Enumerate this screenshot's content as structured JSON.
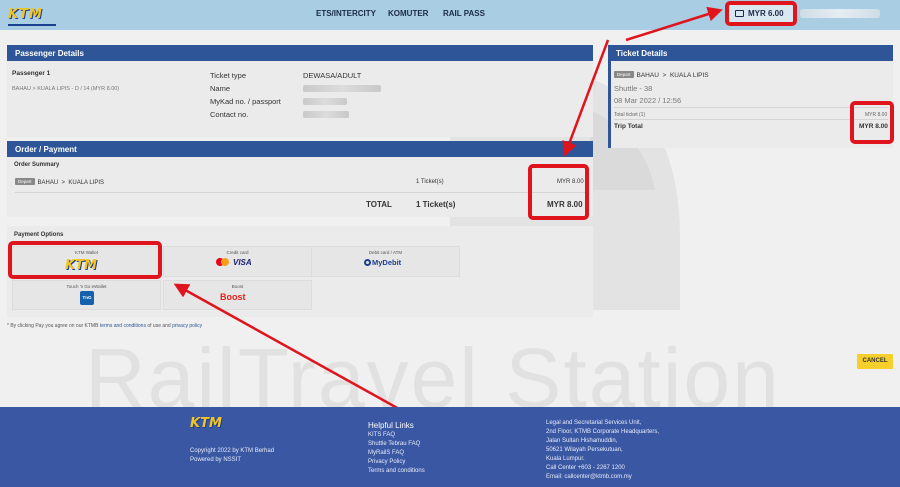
{
  "brand": {
    "logo_text": "KTM"
  },
  "nav": {
    "items": [
      "ETS/INTERCITY",
      "KOMUTER",
      "RAIL PASS"
    ]
  },
  "wallet": {
    "balance": "MYR 6.00",
    "icon": "wallet-icon"
  },
  "watermark": "RailTravel Station",
  "passenger_details": {
    "title": "Passenger Details",
    "passenger_label": "Passenger 1",
    "journey_summary": "BAHAU > KUALA LIPIS - D / 14 (MYR 8.00)",
    "fields": [
      {
        "label": "Ticket type",
        "value": "DEWASA/ADULT"
      },
      {
        "label": "Name",
        "value": ""
      },
      {
        "label": "MyKad no. / passport",
        "value": ""
      },
      {
        "label": "Contact no.",
        "value": ""
      }
    ]
  },
  "order": {
    "title": "Order / Payment",
    "summary_label": "Order Summary",
    "badge": "Depart",
    "origin": "BAHAU",
    "destination": "KUALA LIPIS",
    "tickets": "1 Ticket(s)",
    "price": "MYR 8.00",
    "total_label": "TOTAL",
    "total_tickets": "1 Ticket(s)",
    "total_price": "MYR 8.00"
  },
  "payment": {
    "title": "Payment Options",
    "options": [
      {
        "title": "KTM Wallet",
        "brand": "KTM"
      },
      {
        "title": "Credit card",
        "brand": "VISA"
      },
      {
        "title": "Debit card / ATM",
        "brand": "MyDebit"
      },
      {
        "title": "Touch 'n Go eWallet",
        "brand": "TnG"
      },
      {
        "title": "Boost",
        "brand": "Boost"
      }
    ],
    "terms_prefix": "* By clicking Pay you agree on our KTMB ",
    "terms_link": "terms and conditions",
    "terms_mid": " of use and ",
    "privacy_link": "privacy policy"
  },
  "ticket_details": {
    "title": "Ticket Details",
    "badge": "Depart",
    "origin": "BAHAU",
    "destination": "KUALA LIPIS",
    "service": "Shuttle - 38",
    "datetime": "08 Mar 2022 / 12:56",
    "total_ticket_label": "Total ticket (1)",
    "total_ticket_value": "MYR 8.00",
    "trip_total_label": "Trip Total",
    "trip_total_value": "MYR 8.00"
  },
  "actions": {
    "cancel": "CANCEL"
  },
  "footer": {
    "copyright": "Copyright 2022 by KTM Berhad",
    "powered": "Powered by NSSIT",
    "helpful_title": "Helpful Links",
    "links": [
      "KITS FAQ",
      "Shuttle Tebrau FAQ",
      "MyRailS FAQ",
      "Privacy Policy",
      "Terms and conditions"
    ],
    "address": [
      "Legal and Secretarial Services Unit,",
      "2nd Floor, KTMB Corporate Headquarters,",
      "Jalan Sultan Hishamuddin,",
      "50621 Wilayah Persekutuan,",
      "Kuala Lumpur.",
      "Call Center +603 - 2267 1200",
      "Email: callcenter@ktmb.com.my"
    ]
  },
  "colors": {
    "accent": "#2e5597",
    "highlight": "#e0141c",
    "button": "#f6cf2d"
  }
}
